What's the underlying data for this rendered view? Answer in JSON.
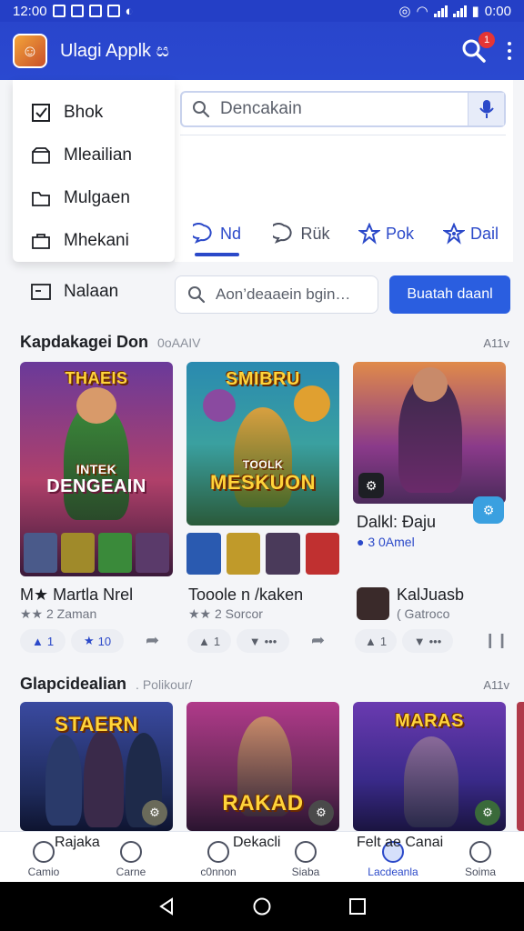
{
  "status_bar": {
    "time_left": "12:00",
    "time_right": "0:00"
  },
  "app_bar": {
    "title": "Ulagi Applk ස",
    "notification_count": "1"
  },
  "drawer": {
    "items": [
      {
        "label": "Bhok",
        "icon": "checkbox-icon"
      },
      {
        "label": "Mleailian",
        "icon": "box-icon"
      },
      {
        "label": "Mulgaen",
        "icon": "folder-icon"
      },
      {
        "label": "Mhekani",
        "icon": "bag-icon"
      }
    ],
    "extra_item": {
      "label": "Nalaan",
      "icon": "card-icon"
    }
  },
  "search": {
    "placeholder": "Dencakain"
  },
  "tabs": [
    {
      "label": "Nd",
      "icon": "chat-icon",
      "active": true
    },
    {
      "label": "Rük",
      "icon": "comment-icon",
      "active": false
    },
    {
      "label": "Pok",
      "icon": "star-icon",
      "active": false
    },
    {
      "label": "Dail",
      "icon": "star-gear-icon",
      "active": false
    }
  ],
  "secondary_search": {
    "placeholder": "Aon’deaaein bgin…",
    "button_label": "Buatah daanl"
  },
  "section1": {
    "title": "Kapdakagei Don",
    "subtitle": "0oAAIV",
    "action": "A11v",
    "cards": [
      {
        "art_title_top": "THAEIS",
        "art_title_bottom": "DENGEAIN",
        "art_tag": "INTEK",
        "title": "M★ Martla Nrel",
        "sub": "★★ 2 Zaman",
        "likes": "1",
        "stars": "10",
        "accent": "#7a3aa8"
      },
      {
        "art_title_top": "SMIBRU",
        "art_title_bottom": "MESKUON",
        "art_tag": "TOOLK",
        "title": "Tooole n /kaken",
        "sub": "★★ 2 Sorcor",
        "likes": "1",
        "stars": "•••",
        "accent": "#2a7ab0"
      },
      {
        "art_title_top": "",
        "art_title_bottom": "",
        "art_tag": "",
        "title": "Dalkl: Đaju",
        "sub": "● 3 0Amel",
        "likes": "1",
        "stars": "•••",
        "accent": "#5a3aa0"
      }
    ],
    "extra_row": {
      "title": "KalJuasb",
      "sub": "( Gatroco"
    }
  },
  "section2": {
    "title": "Glapcidealian",
    "subtitle": ". Polikour/",
    "action": "A11v",
    "cards": [
      {
        "art_title": "STAERN",
        "accent": "#1e3a7a"
      },
      {
        "art_title": "RAKAD",
        "accent": "#8a2a3a"
      },
      {
        "art_title": "MARAS",
        "accent": "#3a3aa0"
      }
    ]
  },
  "overlap_labels": [
    {
      "text": "Rajaka"
    },
    {
      "text": "Dekacli"
    },
    {
      "text": "Felt ae Canai"
    }
  ],
  "bottom_nav": [
    {
      "label": "Camio",
      "active": false
    },
    {
      "label": "Carne",
      "active": false
    },
    {
      "label": "c0nnon",
      "active": false
    },
    {
      "label": "Siaba",
      "active": false
    },
    {
      "label": "Lacdeanla",
      "active": true
    },
    {
      "label": "Soima",
      "active": false
    }
  ],
  "colors": {
    "primary": "#2a49d0",
    "accent_button": "#2a5ee0",
    "notification": "#e53535"
  }
}
